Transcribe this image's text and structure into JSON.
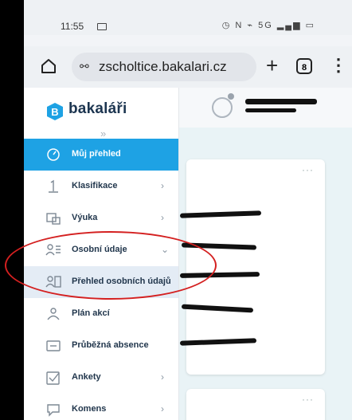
{
  "status_bar": {
    "time": "11:55",
    "indicators": "◷ N ⌁ 5G ▂▄▆ ▭"
  },
  "browser": {
    "url": "zscholtice.bakalari.cz",
    "tab_count": "8",
    "icons": [
      "home-icon",
      "tune-icon",
      "new-tab-icon",
      "tabs-icon",
      "menu-icon"
    ]
  },
  "brand": {
    "name": "bakaláři"
  },
  "sidebar": {
    "items": [
      {
        "label": "Můj přehled",
        "icon": "dashboard-icon",
        "state": "active"
      },
      {
        "label": "Klasifikace",
        "icon": "grade-icon",
        "chevron": "›"
      },
      {
        "label": "Výuka",
        "icon": "lessons-icon",
        "chevron": "›"
      },
      {
        "label": "Osobní údaje",
        "icon": "personal-data-icon",
        "chevron": "⌄"
      },
      {
        "label": "Přehled osobních údajů",
        "icon": "personal-overview-icon",
        "state": "selected"
      },
      {
        "label": "Plán akcí",
        "icon": "events-icon"
      },
      {
        "label": "Průběžná absence",
        "icon": "absence-icon"
      },
      {
        "label": "Ankety",
        "icon": "poll-icon",
        "chevron": "›"
      },
      {
        "label": "Komens",
        "icon": "messages-icon",
        "chevron": "›"
      }
    ]
  },
  "content": {
    "card_menu": "···"
  },
  "colors": {
    "accent": "#1ea2e4",
    "brand_text": "#1c3550",
    "annotation": "#d42020"
  }
}
